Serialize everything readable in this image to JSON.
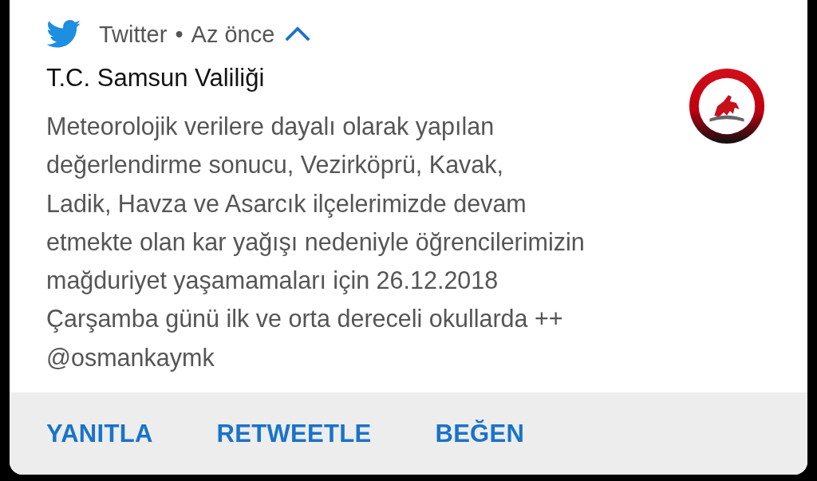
{
  "header": {
    "app": "Twitter",
    "separator": "•",
    "time": "Az önce",
    "expanded": true
  },
  "notification": {
    "title": "T.C. Samsun Valiliği",
    "lines": [
      "Meteorolojik verilere dayalı olarak yapılan",
      "değerlendirme sonucu, Vezirköprü, Kavak,",
      "Ladik, Havza ve Asarcık ilçelerimizde devam",
      "etmekte olan kar yağışı nedeniyle öğrencilerimizin",
      "mağduriyet yaşamamaları için 26.12.2018",
      "Çarşamba günü ilk ve orta dereceli okullarda ++",
      "@osmankaymk"
    ]
  },
  "actions": [
    "YANITLA",
    "RETWEETLE",
    "BEĞEN"
  ]
}
